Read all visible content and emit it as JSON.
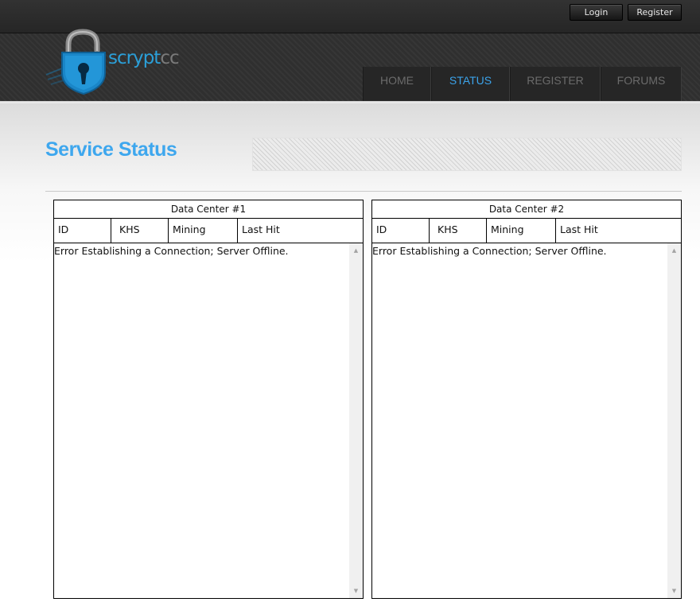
{
  "topbar": {
    "login_label": "Login",
    "register_label": "Register"
  },
  "logo": {
    "text_scrypt": "scrypt",
    "text_cc": "cc",
    "icon": "padlock-keyhole-icon"
  },
  "nav": {
    "items": [
      {
        "label": "HOME",
        "active": false
      },
      {
        "label": "STATUS",
        "active": true
      },
      {
        "label": "REGISTER",
        "active": false
      },
      {
        "label": "FORUMS",
        "active": false
      }
    ]
  },
  "page": {
    "title": "Service Status"
  },
  "panels": [
    {
      "title": "Data Center #1",
      "columns": [
        "ID",
        "KHS",
        "Mining",
        "Last Hit"
      ],
      "message": "Error Establishing a Connection; Server Offline."
    },
    {
      "title": "Data Center #2",
      "columns": [
        "ID",
        "KHS",
        "Mining",
        "Last Hit"
      ],
      "message": "Error Establishing a Connection; Server Offline."
    }
  ],
  "icons": {
    "scroll_up": "scroll-up-arrow-icon",
    "scroll_down": "scroll-down-arrow-icon"
  },
  "colors": {
    "accent_blue": "#3ea7ee",
    "nav_active": "#3ba3ea",
    "logo_blue": "#2b9fd8",
    "topbar_bg": "#2b2b2b"
  }
}
